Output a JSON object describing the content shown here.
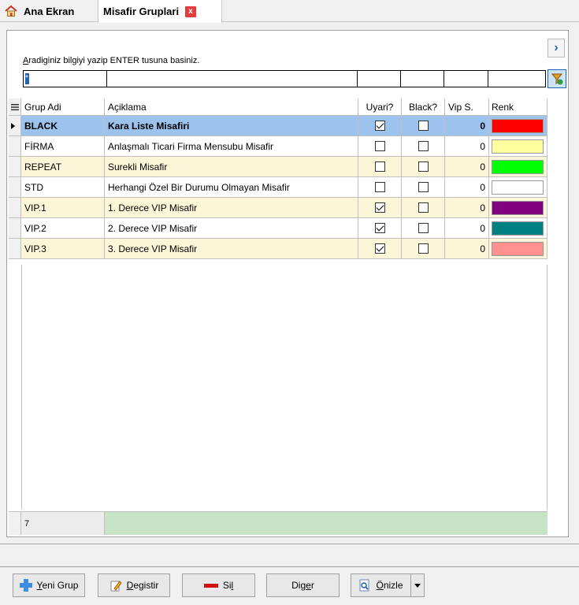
{
  "tabs": {
    "home_label": "Ana Ekran",
    "active_label": "Misafir Gruplari",
    "close_glyph": "x"
  },
  "search": {
    "hint_prefix": "A",
    "hint_rest": "radiginiz bilgiyi yazip ENTER tusuna basiniz.",
    "first_value": "*",
    "nav_glyph": "›"
  },
  "grid": {
    "headers": {
      "grup": "Grup Adi",
      "aciklama": "Açiklama",
      "uyari": "Uyari?",
      "black": "Black?",
      "vip": "Vip S.",
      "renk": "Renk"
    },
    "rows": [
      {
        "grup": "BLACK",
        "aciklama": "Kara Liste Misafiri",
        "uyari": true,
        "black": false,
        "vip": "0",
        "renk": "#ff0000"
      },
      {
        "grup": "FİRMA",
        "aciklama": "Anlaşmalı Ticari Firma Mensubu Misafir",
        "uyari": false,
        "black": false,
        "vip": "0",
        "renk": "#ffffa0"
      },
      {
        "grup": "REPEAT",
        "aciklama": "Surekli Misafir",
        "uyari": false,
        "black": false,
        "vip": "0",
        "renk": "#00ff00"
      },
      {
        "grup": "STD",
        "aciklama": "Herhangi Özel Bir Durumu Olmayan Misafir",
        "uyari": false,
        "black": false,
        "vip": "0",
        "renk": "#ffffff"
      },
      {
        "grup": "VIP.1",
        "aciklama": "1. Derece VIP Misafir",
        "uyari": true,
        "black": false,
        "vip": "0",
        "renk": "#800080"
      },
      {
        "grup": "VIP.2",
        "aciklama": "2. Derece VIP Misafir",
        "uyari": true,
        "black": false,
        "vip": "0",
        "renk": "#008080"
      },
      {
        "grup": "VIP.3",
        "aciklama": "3. Derece VIP Misafir",
        "uyari": true,
        "black": false,
        "vip": "0",
        "renk": "#ff9090"
      }
    ],
    "count": "7"
  },
  "buttons": {
    "yeni_u": "Y",
    "yeni_rest": "eni Grup",
    "degistir_u": "D",
    "degistir_rest": "egistir",
    "sil_pre": "Si",
    "sil_u": "l",
    "diger_pre": "Dig",
    "diger_u": "e",
    "diger_rest": "r",
    "onizle_u": "Ö",
    "onizle_rest": "nizle"
  }
}
